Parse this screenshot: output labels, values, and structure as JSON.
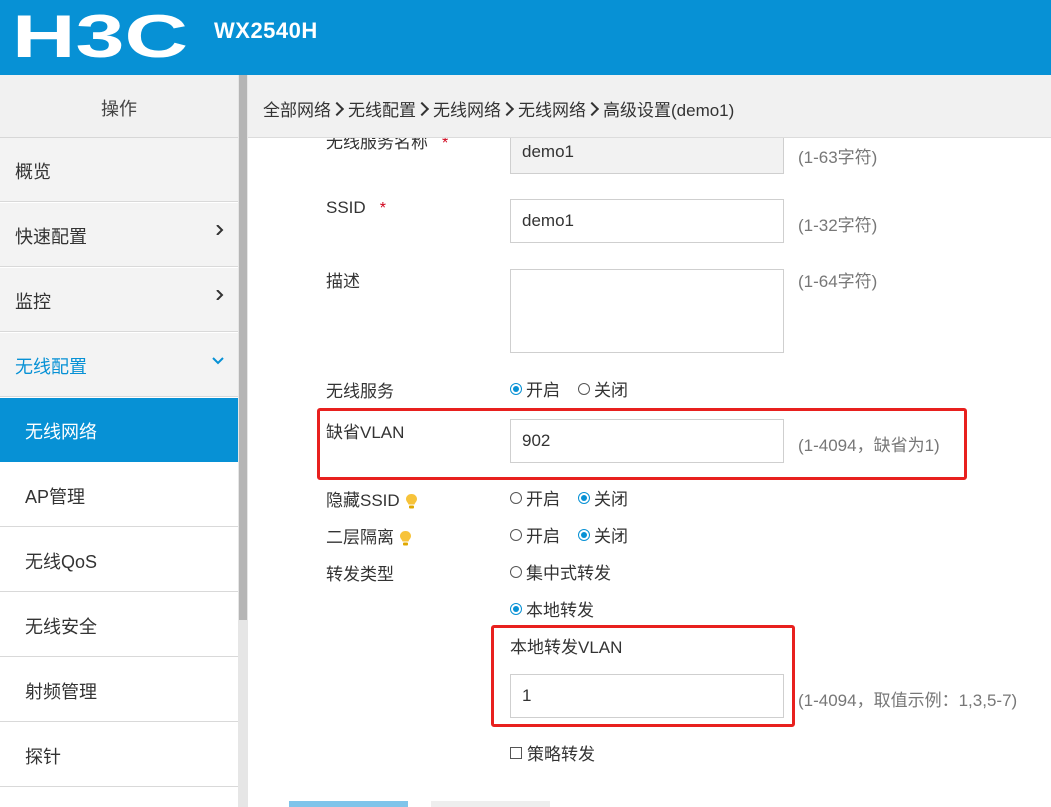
{
  "header": {
    "logo_text": "H3C",
    "model": "WX2540H"
  },
  "sidebar": {
    "title": "操作",
    "items": [
      {
        "label": "概览"
      },
      {
        "label": "快速配置"
      },
      {
        "label": "监控"
      },
      {
        "label": "无线配置"
      },
      {
        "label": "无线网络"
      },
      {
        "label": "AP管理"
      },
      {
        "label": "无线QoS"
      },
      {
        "label": "无线安全"
      },
      {
        "label": "射频管理"
      },
      {
        "label": "探针"
      }
    ]
  },
  "breadcrumb": [
    "全部网络",
    "无线配置",
    "无线网络",
    "无线网络",
    "高级设置(demo1)"
  ],
  "form": {
    "service_name": {
      "label": "无线服务名称",
      "value": "demo1",
      "hint": "(1-63字符)"
    },
    "ssid": {
      "label": "SSID",
      "value": "demo1",
      "hint": "(1-32字符)"
    },
    "desc": {
      "label": "描述",
      "value": "",
      "hint": "(1-64字符)"
    },
    "required_mark": "*",
    "wireless_service": {
      "label": "无线服务",
      "on": "开启",
      "off": "关闭",
      "selected": "on"
    },
    "default_vlan": {
      "label": "缺省VLAN",
      "value": "902",
      "hint": "(1-4094，缺省为1)"
    },
    "hide_ssid": {
      "label": "隐藏SSID",
      "on": "开启",
      "off": "关闭",
      "selected": "off"
    },
    "l2_isolation": {
      "label": "二层隔离",
      "on": "开启",
      "off": "关闭",
      "selected": "off"
    },
    "forward_type": {
      "label": "转发类型",
      "central": "集中式转发",
      "local": "本地转发",
      "selected": "local"
    },
    "local_vlan": {
      "label": "本地转发VLAN",
      "value": "1",
      "hint": "(1-4094，取值示例：1,3,5-7)"
    },
    "policy_forward": {
      "label": "策略转发",
      "checked": false
    }
  },
  "colors": {
    "brand": "#0791d5",
    "highlight": "#e8201e",
    "required": "#d0021b"
  }
}
